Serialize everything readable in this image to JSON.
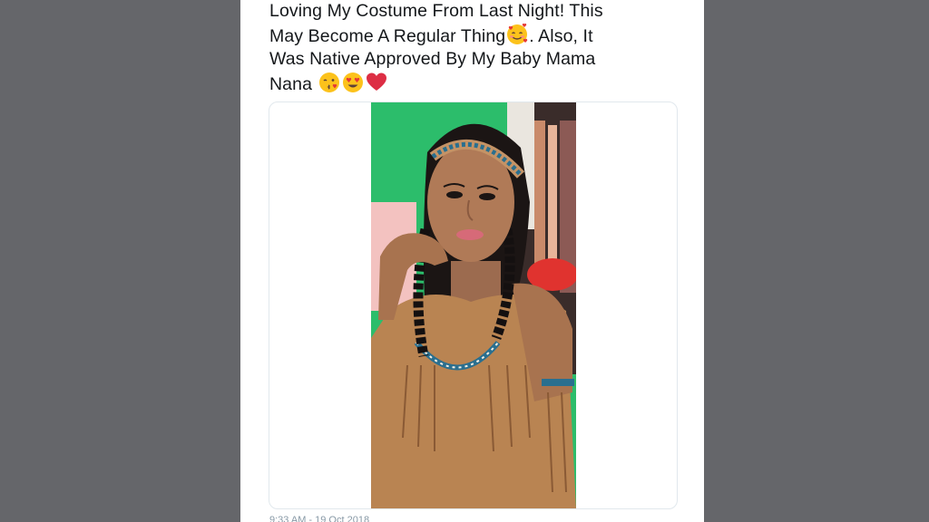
{
  "tweet": {
    "text_parts": {
      "line1": "Loving My Costume From Last Night! This",
      "line2a": "May Become A Regular Thing",
      "line2b": ". Also, It",
      "line3": "Was Native Approved By My Baby Mama",
      "line4": "Nana "
    },
    "emojis": [
      "smiling-face-with-hearts",
      "face-blowing-a-kiss",
      "smiling-face-with-heart-eyes",
      "red-heart"
    ],
    "timestamp": "9:33 AM - 19 Oct 2018"
  },
  "colors": {
    "background": "#65666a",
    "card": "#ffffff",
    "text": "#14171a",
    "border": "#e1e8ed"
  }
}
